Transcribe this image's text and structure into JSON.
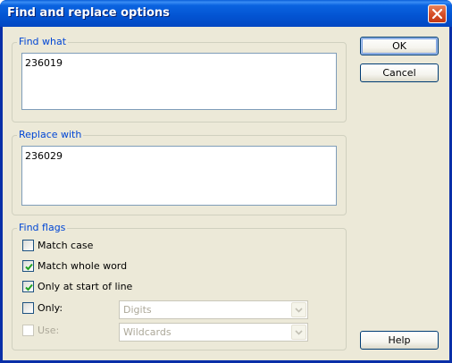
{
  "window": {
    "title": "Find and replace options"
  },
  "find": {
    "legend": "Find what",
    "value": "236019"
  },
  "replace": {
    "legend": "Replace with",
    "value": "236029"
  },
  "flags": {
    "legend": "Find flags",
    "match_case": {
      "label": "Match case",
      "checked": false
    },
    "match_whole_word": {
      "label": "Match whole word",
      "checked": true
    },
    "only_start_of_line": {
      "label": "Only at start of line",
      "checked": true
    },
    "only": {
      "label": "Only:",
      "checked": false,
      "selected": "Digits"
    },
    "use": {
      "label": "Use:",
      "checked": false,
      "enabled": false,
      "selected": "Wildcards"
    }
  },
  "buttons": {
    "ok": "OK",
    "cancel": "Cancel",
    "help": "Help"
  },
  "colors": {
    "titlebar": "#0554d3",
    "dialog_bg": "#ece9d8",
    "legend_text": "#0046d5",
    "check_mark": "#21a121"
  },
  "icons": {
    "close": "close-icon",
    "check": "check-icon",
    "dropdown": "chevron-down-icon"
  }
}
